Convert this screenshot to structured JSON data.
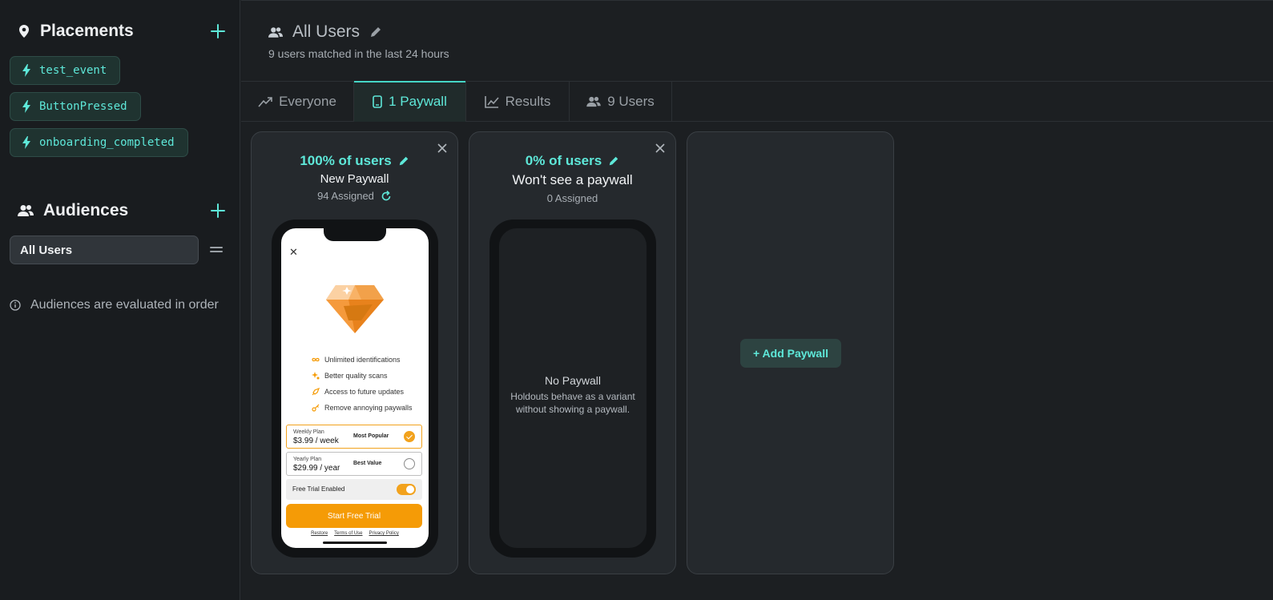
{
  "sidebar": {
    "placements": {
      "title": "Placements",
      "items": [
        {
          "label": "test_event"
        },
        {
          "label": "ButtonPressed"
        },
        {
          "label": "onboarding_completed"
        }
      ]
    },
    "audiences": {
      "title": "Audiences",
      "items": [
        {
          "label": "All Users"
        }
      ],
      "info": "Audiences are evaluated in order"
    }
  },
  "header": {
    "title": "All Users",
    "subtitle": "9 users matched in the last 24 hours"
  },
  "tabs": [
    {
      "label": "Everyone",
      "icon": "split-icon"
    },
    {
      "label": "1 Paywall",
      "icon": "phone-icon",
      "active": true
    },
    {
      "label": "Results",
      "icon": "chart-icon"
    },
    {
      "label": "9 Users",
      "icon": "users-icon"
    }
  ],
  "cards": [
    {
      "percent": "100% of users",
      "name": "New Paywall",
      "assigned": "94 Assigned",
      "paywall": {
        "features": [
          "Unlimited identifications",
          "Better quality scans",
          "Access to future updates",
          "Remove annoying paywalls"
        ],
        "plans": [
          {
            "name": "Weekly Plan",
            "price": "$3.99 / week",
            "badge": "Most Popular"
          },
          {
            "name": "Yearly Plan",
            "price": "$29.99 / year",
            "badge": "Best Value"
          }
        ],
        "trial_label": "Free Trial Enabled",
        "cta": "Start Free Trial",
        "links": [
          "Restore",
          "Terms of Use",
          "Privacy Policy"
        ]
      }
    },
    {
      "percent": "0% of users",
      "name": "Won't see a paywall",
      "assigned": "0 Assigned",
      "empty_title": "No Paywall",
      "empty_desc": "Holdouts behave as a variant without showing a paywall."
    }
  ],
  "add_paywall_label": "+ Add Paywall",
  "colors": {
    "accent": "#5ee8d9",
    "background": "#1c1f22",
    "paywall_orange": "#f59b06"
  }
}
